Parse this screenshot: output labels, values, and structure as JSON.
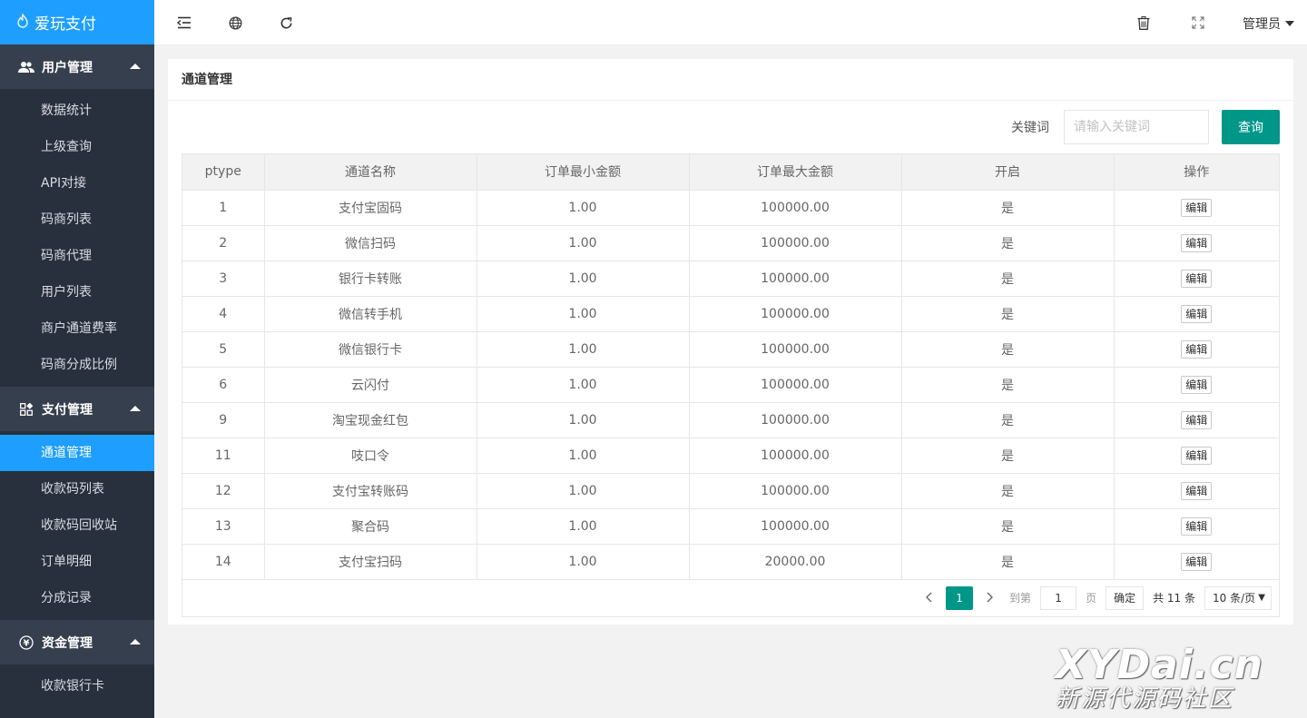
{
  "brand": {
    "name": "爱玩支付"
  },
  "sidebar": {
    "groups": [
      {
        "title": "用户管理",
        "icon": "users-icon",
        "items": [
          "数据统计",
          "上级查询",
          "API对接",
          "码商列表",
          "码商代理",
          "用户列表",
          "商户通道费率",
          "码商分成比例"
        ]
      },
      {
        "title": "支付管理",
        "icon": "apps-icon",
        "items": [
          "通道管理",
          "收款码列表",
          "收款码回收站",
          "订单明细",
          "分成记录"
        ]
      },
      {
        "title": "资金管理",
        "icon": "yen-icon",
        "items": [
          "收款银行卡"
        ]
      }
    ],
    "active_item": "通道管理"
  },
  "header": {
    "icons": [
      "menu-collapse-icon",
      "globe-icon",
      "refresh-icon",
      "trash-icon",
      "fullscreen-icon"
    ],
    "user_label": "管理员"
  },
  "card": {
    "title": "通道管理",
    "search": {
      "label": "关键词",
      "placeholder": "请输入关键词",
      "button": "查询"
    }
  },
  "table": {
    "columns": [
      "ptype",
      "通道名称",
      "订单最小金额",
      "订单最大金额",
      "开启",
      "操作"
    ],
    "action_label": "编辑",
    "rows": [
      [
        "1",
        "支付宝固码",
        "1.00",
        "100000.00",
        "是"
      ],
      [
        "2",
        "微信扫码",
        "1.00",
        "100000.00",
        "是"
      ],
      [
        "3",
        "银行卡转账",
        "1.00",
        "100000.00",
        "是"
      ],
      [
        "4",
        "微信转手机",
        "1.00",
        "100000.00",
        "是"
      ],
      [
        "5",
        "微信银行卡",
        "1.00",
        "100000.00",
        "是"
      ],
      [
        "6",
        "云闪付",
        "1.00",
        "100000.00",
        "是"
      ],
      [
        "9",
        "淘宝现金红包",
        "1.00",
        "100000.00",
        "是"
      ],
      [
        "11",
        "吱口令",
        "1.00",
        "100000.00",
        "是"
      ],
      [
        "12",
        "支付宝转账码",
        "1.00",
        "100000.00",
        "是"
      ],
      [
        "13",
        "聚合码",
        "1.00",
        "100000.00",
        "是"
      ],
      [
        "14",
        "支付宝扫码",
        "1.00",
        "20000.00",
        "是"
      ]
    ]
  },
  "pager": {
    "current": "1",
    "goto_label": "到第",
    "page_input": "1",
    "page_suffix": "页",
    "confirm": "确定",
    "total": "共 11 条",
    "limit": "10 条/页"
  },
  "watermark": {
    "line1": "XYDai.cn",
    "line2": "新源代源码社区"
  },
  "colors": {
    "brand_blue": "#1e9fff",
    "sidebar_bg": "#28303d",
    "primary_green": "#009688"
  }
}
